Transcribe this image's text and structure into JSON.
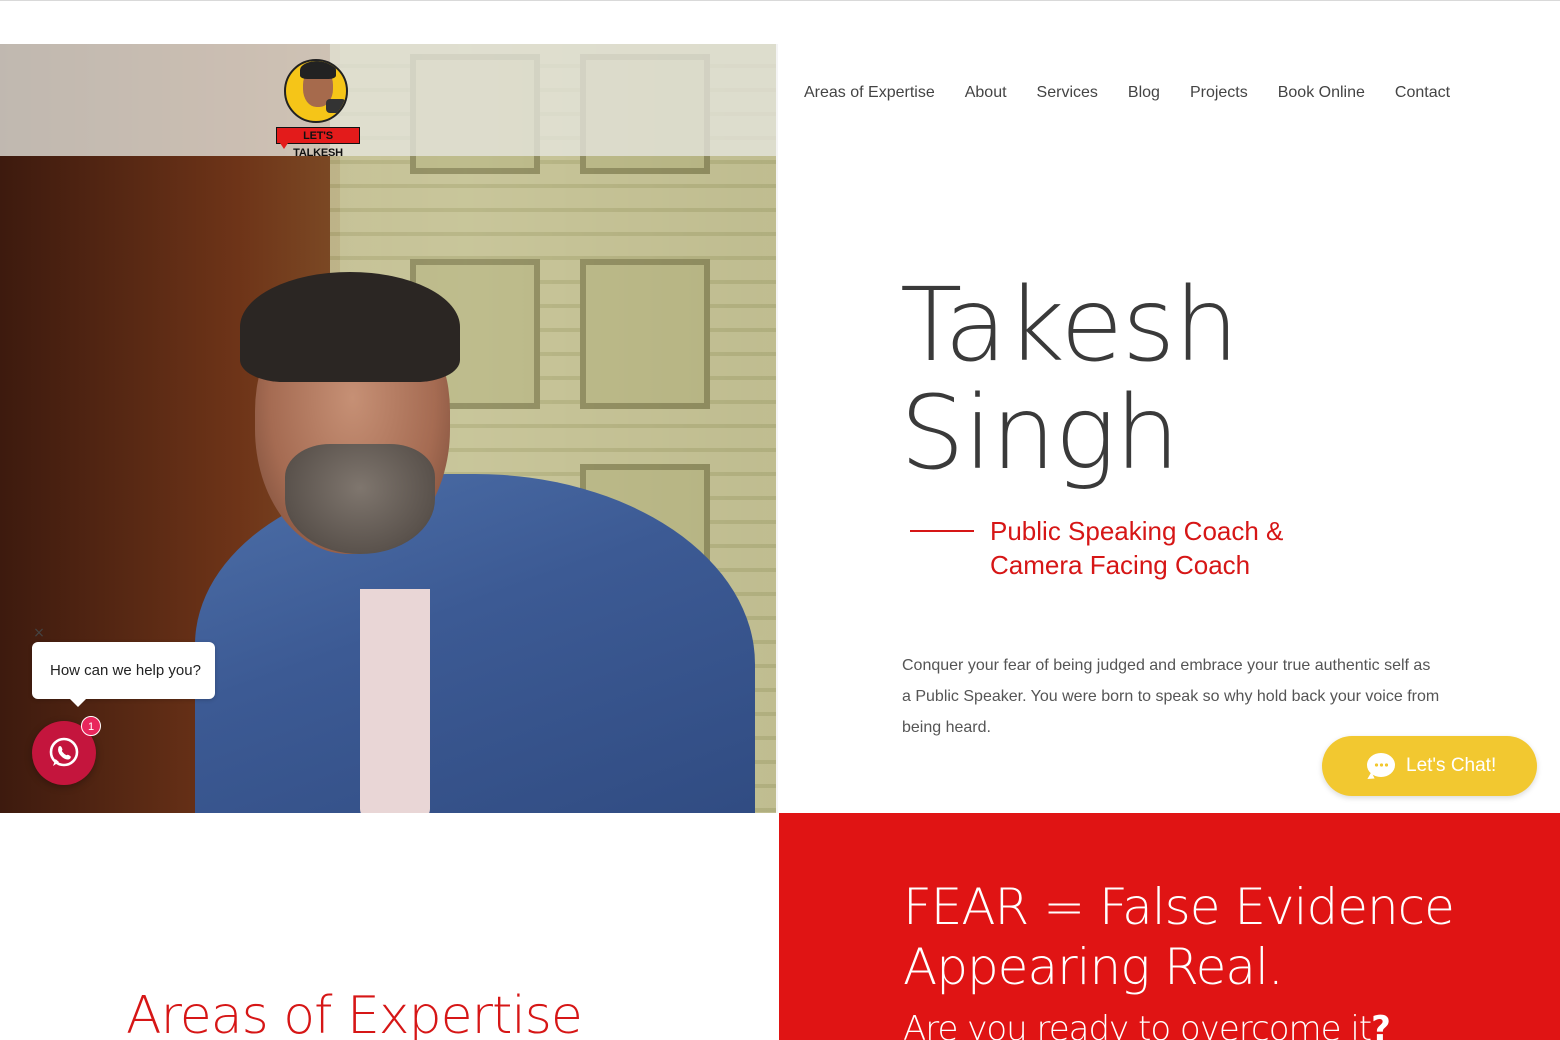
{
  "brand": {
    "logo_text": "LET'S TALKESH"
  },
  "nav": {
    "items": [
      "Areas of Expertise",
      "About",
      "Services",
      "Blog",
      "Projects",
      "Book Online",
      "Contact"
    ]
  },
  "hero": {
    "name_line1": "Takesh",
    "name_line2": "Singh",
    "subtitle_line1": "Public Speaking Coach &",
    "subtitle_line2": "Camera Facing Coach",
    "description": "Conquer your fear of being judged and embrace your true authentic self as a Public Speaker. You were born to speak so why hold back your voice from being heard."
  },
  "chat": {
    "label": "Let's Chat!",
    "icon": "chat-bubble-icon"
  },
  "whatsapp": {
    "close": "×",
    "prompt": "How can we help you?",
    "badge_count": "1",
    "icon": "whatsapp-icon"
  },
  "sections": {
    "areas_title": "Areas of Expertise",
    "fear_title": "FEAR = False Evidence Appearing Real.",
    "fear_subtitle": "Are you ready to overcome it",
    "fear_subtitle_mark": "?"
  },
  "colors": {
    "accent_red": "#d61616",
    "panel_red": "#e01414",
    "chat_yellow": "#f2c830",
    "whatsapp_red": "#c4153d"
  }
}
